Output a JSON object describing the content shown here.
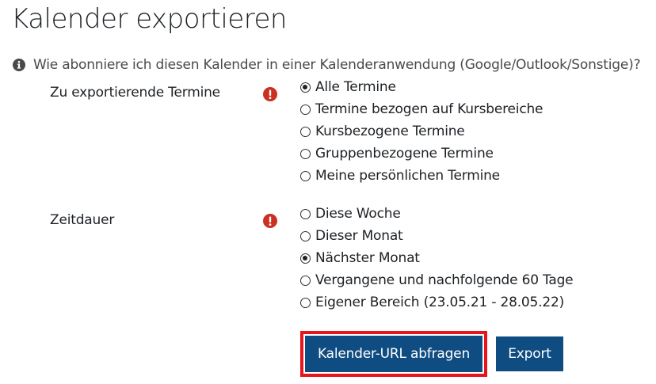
{
  "page": {
    "title": "Kalender exportieren"
  },
  "help": {
    "icon": "info-icon",
    "text": "Wie abonniere ich diesen Kalender in einer Kalenderanwendung (Google/Outlook/Sonstige)?"
  },
  "events_field": {
    "label": "Zu exportierende Termine",
    "required_icon": "exclamation-circle-icon",
    "options": [
      {
        "label": "Alle Termine",
        "checked": true
      },
      {
        "label": "Termine bezogen auf Kursbereiche",
        "checked": false
      },
      {
        "label": "Kursbezogene Termine",
        "checked": false
      },
      {
        "label": "Gruppenbezogene Termine",
        "checked": false
      },
      {
        "label": "Meine persönlichen Termine",
        "checked": false
      }
    ]
  },
  "period_field": {
    "label": "Zeitdauer",
    "required_icon": "exclamation-circle-icon",
    "options": [
      {
        "label": "Diese Woche",
        "checked": false
      },
      {
        "label": "Dieser Monat",
        "checked": false
      },
      {
        "label": "Nächster Monat",
        "checked": true
      },
      {
        "label": "Vergangene und nachfolgende 60 Tage",
        "checked": false
      },
      {
        "label": "Eigener Bereich (23.05.21 - 28.05.22)",
        "checked": false
      }
    ]
  },
  "actions": {
    "get_url_label": "Kalender-URL abfragen",
    "export_label": "Export"
  },
  "colors": {
    "button_bg": "#0f4c81",
    "highlight": "#e8141c",
    "required": "#ca3120"
  }
}
